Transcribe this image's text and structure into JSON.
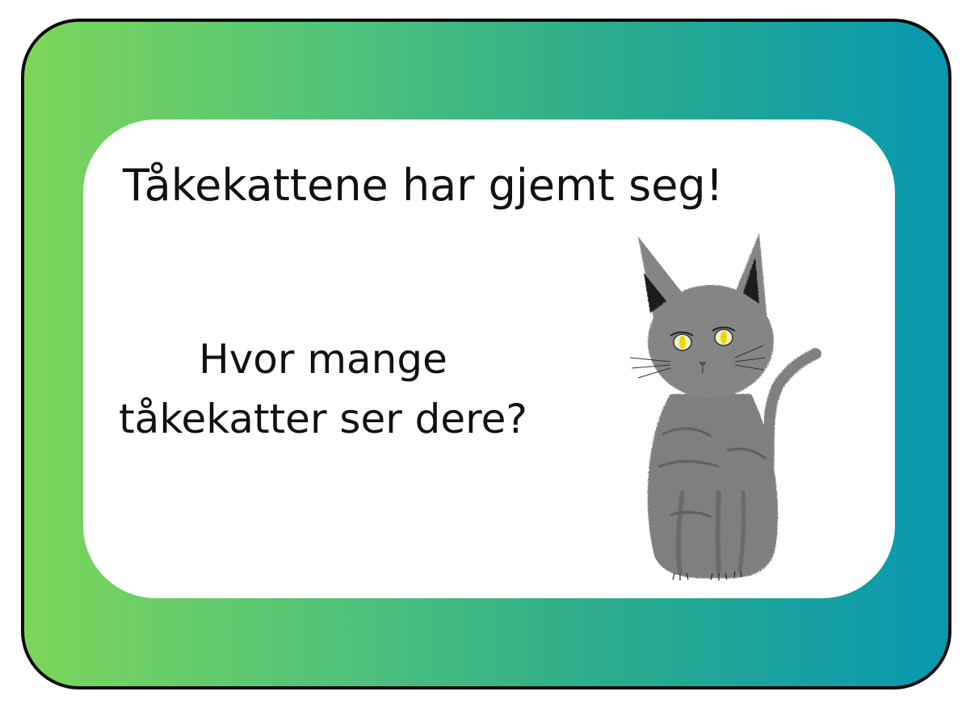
{
  "card": {
    "title": "Tåkekattene har gjemt seg!",
    "question_line1": "Hvor mange",
    "question_line2": "tåkekatter ser dere?"
  },
  "illustration": {
    "subject": "grey-cat",
    "eye_color": "#f0e020",
    "fur_color": "#7a7a7a"
  },
  "colors": {
    "gradient_start": "#7dd65a",
    "gradient_end": "#0898b0",
    "border": "#0b0b0b",
    "panel": "#ffffff"
  }
}
